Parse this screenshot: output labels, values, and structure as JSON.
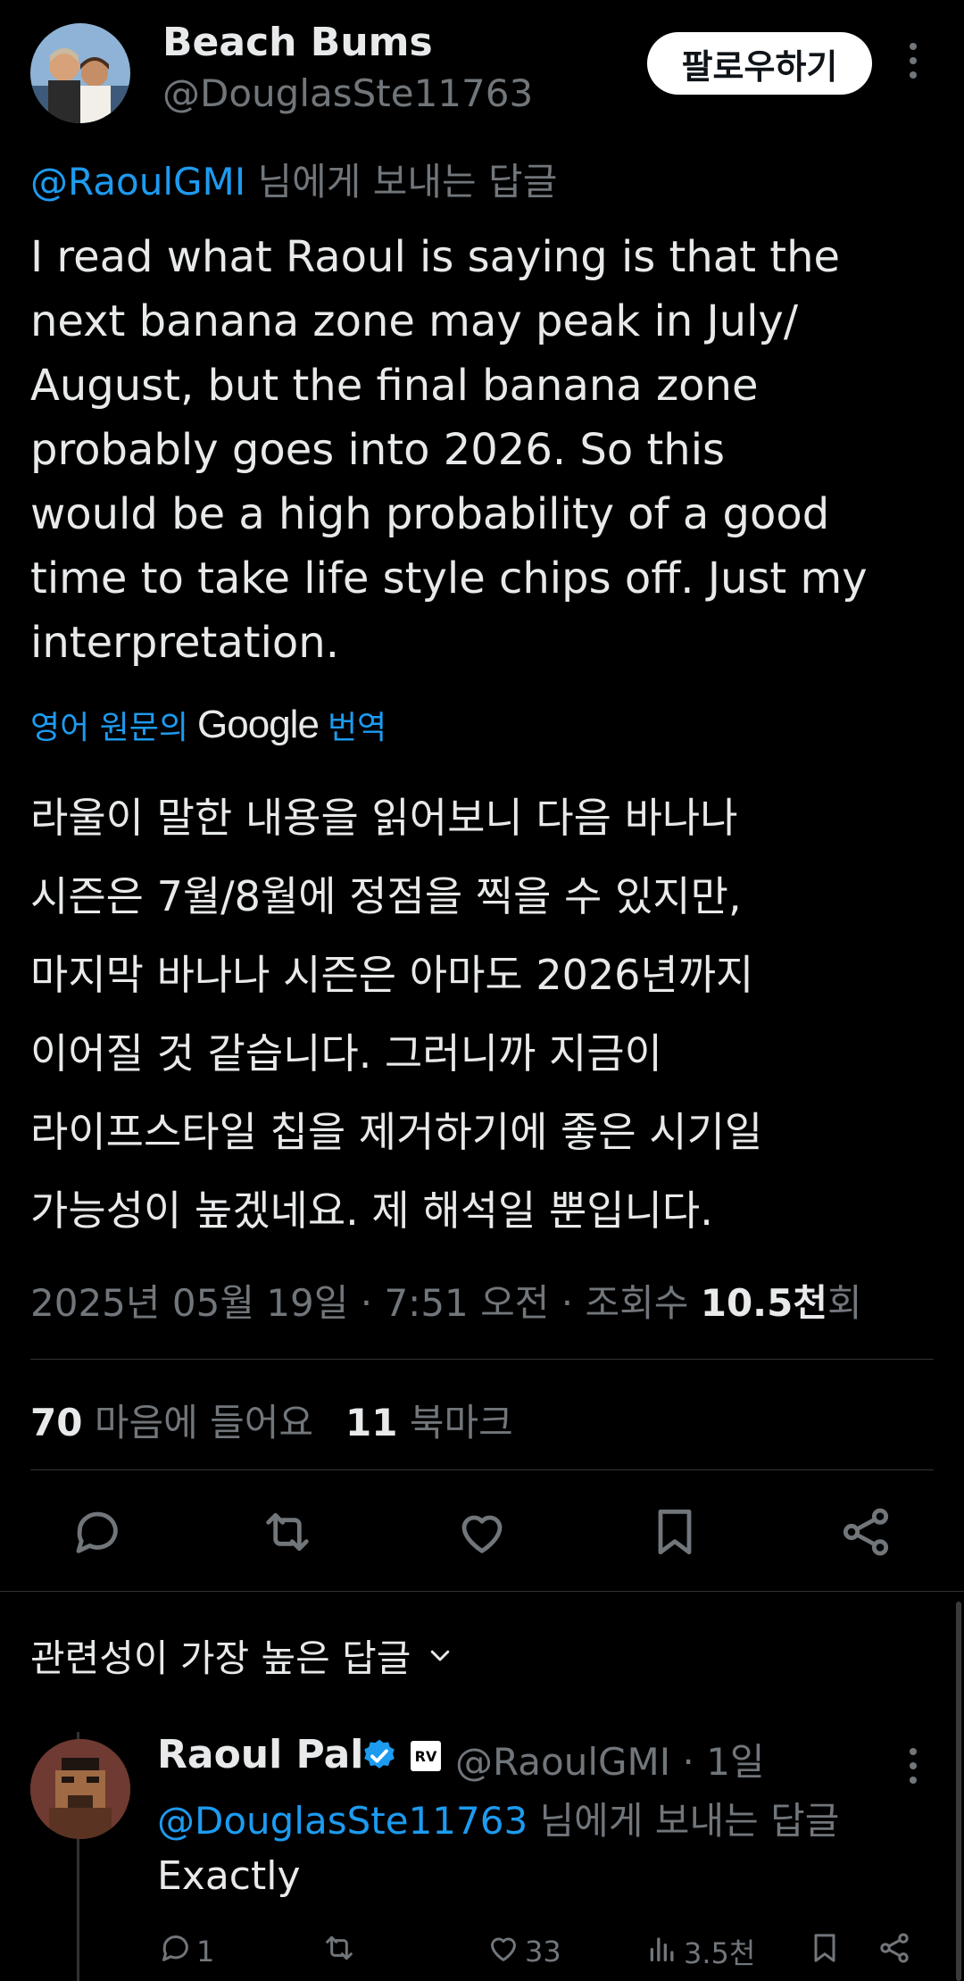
{
  "tweet": {
    "author_name": "Beach Bums",
    "author_handle": "@DouglasSte11763",
    "follow_label": "팔로우하기",
    "reply_mention": "@RaoulGMI",
    "reply_suffix": " 님에게 보내는 답글",
    "body": "I read what Raoul is saying is that the\nnext banana zone may peak in July/\nAugust, but the final banana zone\nprobably goes into 2026.  So this\nwould be a high probability of a good\ntime to take life style chips off.  Just my\ninterpretation.",
    "translate_prefix": "영어 원문의",
    "translate_brand": "Google",
    "translate_suffix": "번역",
    "translated_body": "라울이 말한 내용을 읽어보니 다음 바나나\n시즌은 7월/8월에 정점을 찍을 수 있지만,\n마지막 바나나 시즌은 아마도 2026년까지\n이어질 것 같습니다. 그러니까 지금이\n라이프스타일 칩을 제거하기에 좋은 시기일\n가능성이 높겠네요. 제 해석일 뿐입니다.",
    "meta_prefix": "2025년 05월 19일 · 7:51 오전 · 조회수 ",
    "meta_views": "10.5천",
    "meta_suffix": "회",
    "likes_count": "70",
    "likes_label": "마음에 들어요",
    "bookmarks_count": "11",
    "bookmarks_label": "북마크"
  },
  "actions": {
    "reply_icon": "reply-icon",
    "retweet_icon": "retweet-icon",
    "like_icon": "heart-icon",
    "bookmark_icon": "bookmark-icon",
    "share_icon": "share-icon"
  },
  "replies_section": {
    "title": "관련성이 가장 높은 답글"
  },
  "reply": {
    "author_name": "Raoul Pal",
    "badge_text": "RV",
    "handle_time": "@RaoulGMI · 1일",
    "reply_mention": "@DouglasSte11763",
    "reply_suffix": " 님에게 보내는 답글",
    "body": "Exactly",
    "reply_count": "1",
    "like_count": "33",
    "view_count": "3.5천"
  },
  "colors": {
    "background": "#000000",
    "text_primary": "#e7e9ea",
    "text_secondary": "#71767b",
    "accent": "#1d9bf0",
    "divider": "#2f3336"
  }
}
